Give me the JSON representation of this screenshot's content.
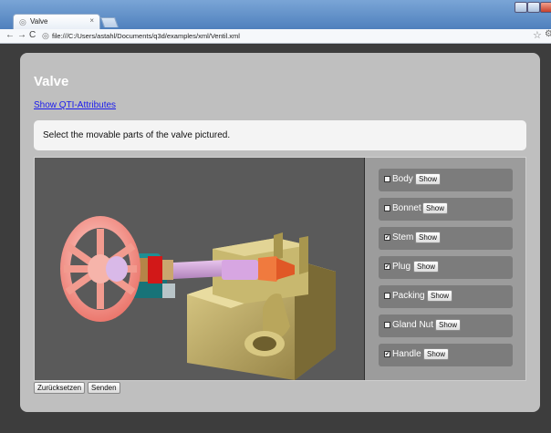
{
  "browser": {
    "tab_title": "Valve",
    "tab_close": "×",
    "address": "file:///C:/Users/astahl/Documents/q3d/examples/xml/Ventil.xml"
  },
  "page": {
    "title": "Valve",
    "qti_link": "Show QTI-Attributes",
    "prompt": "Select the movable parts of the valve pictured."
  },
  "parts": [
    {
      "label": "Body",
      "checked": false,
      "button": "Show"
    },
    {
      "label": "Bonnet",
      "checked": false,
      "button": "Show"
    },
    {
      "label": "Stem",
      "checked": true,
      "button": "Show"
    },
    {
      "label": "Plug",
      "checked": true,
      "button": "Show"
    },
    {
      "label": "Packing",
      "checked": false,
      "button": "Show"
    },
    {
      "label": "Gland Nut",
      "checked": false,
      "button": "Show"
    },
    {
      "label": "Handle",
      "checked": true,
      "button": "Show"
    }
  ],
  "form": {
    "reset_label": "Zurücksetzen",
    "submit_label": "Senden"
  },
  "colors": {
    "card": "#bfbfbf",
    "scene_bg": "#5a5a5a",
    "part_row": "#7c7c7c",
    "link": "#1a1aee"
  }
}
